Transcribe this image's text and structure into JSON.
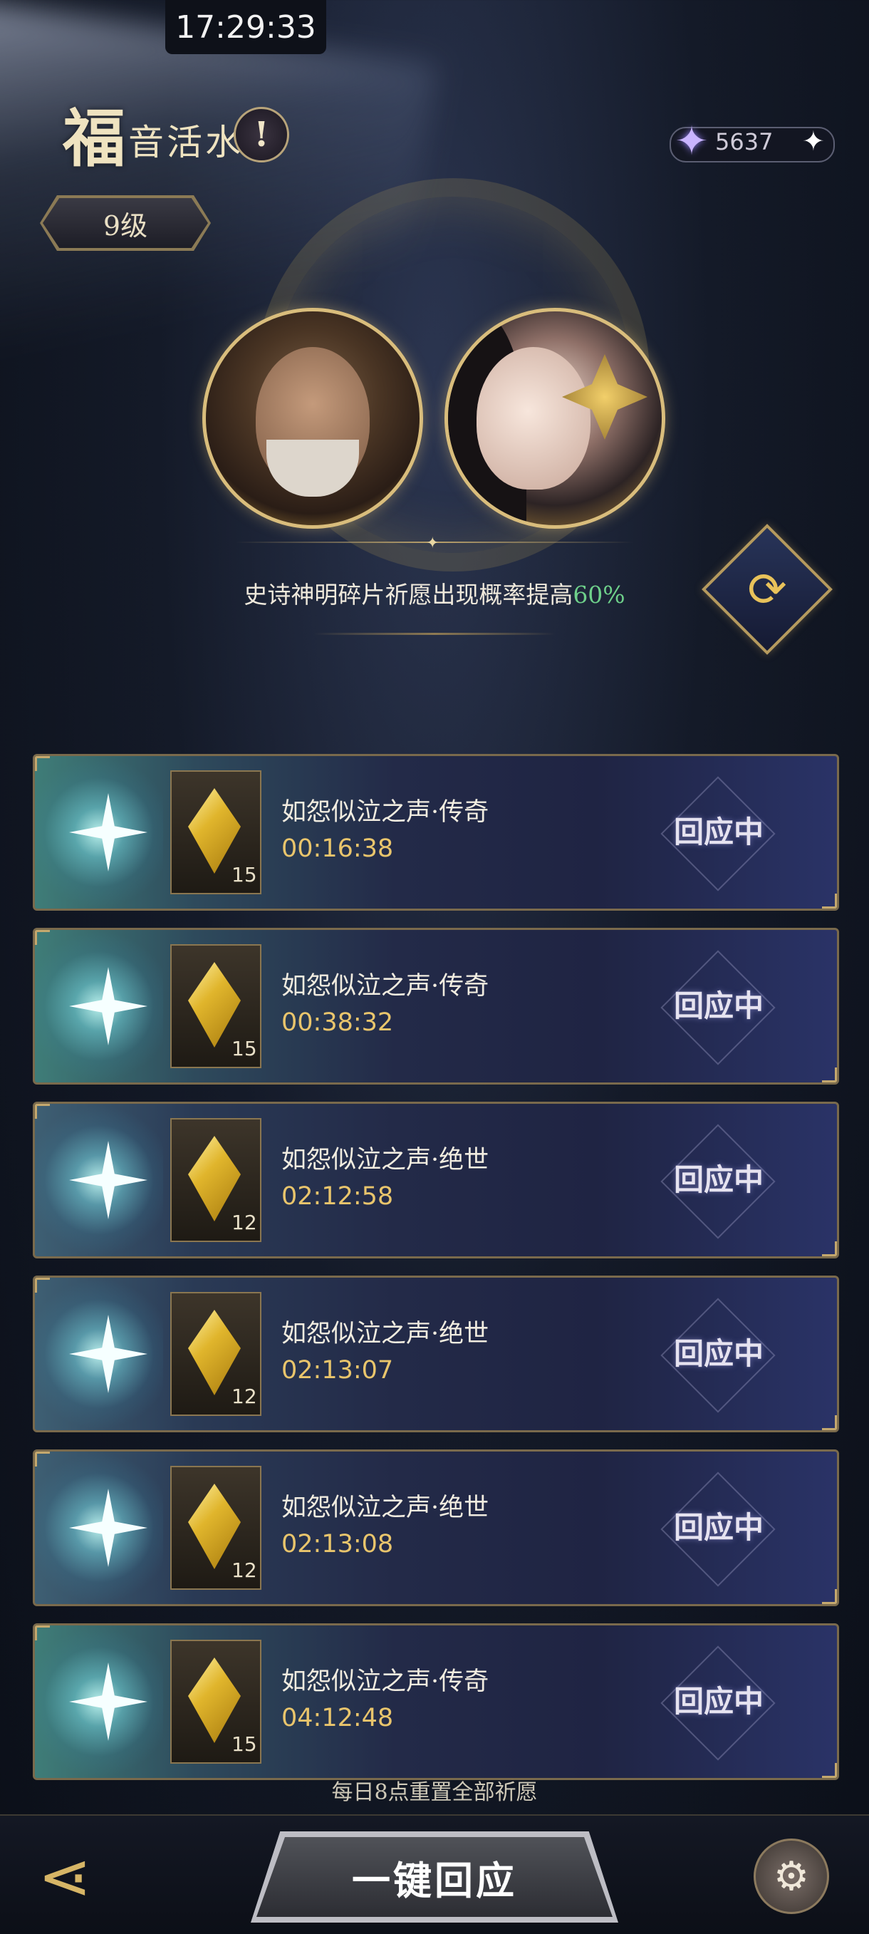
{
  "status_bar": {
    "time": "17:29:33"
  },
  "header": {
    "title_big": "福",
    "title_small": "音活水",
    "info_icon": "exclamation-icon",
    "level": "9级"
  },
  "currency": {
    "icon": "star-gem-icon",
    "value": "5637",
    "plus_icon": "plus-sparkle-icon"
  },
  "banner": {
    "boost_prefix": "史诗神明碎片祈愿出现概率提高",
    "boost_percent": "60%",
    "refresh_icon": "refresh-icon"
  },
  "wishes": [
    {
      "name": "如怨似泣之声·传奇",
      "timer": "00:16:38",
      "count": "15",
      "status": "回应中",
      "tier": "green"
    },
    {
      "name": "如怨似泣之声·传奇",
      "timer": "00:38:32",
      "count": "15",
      "status": "回应中",
      "tier": "green"
    },
    {
      "name": "如怨似泣之声·绝世",
      "timer": "02:12:58",
      "count": "12",
      "status": "回应中",
      "tier": "blue"
    },
    {
      "name": "如怨似泣之声·绝世",
      "timer": "02:13:07",
      "count": "12",
      "status": "回应中",
      "tier": "blue"
    },
    {
      "name": "如怨似泣之声·绝世",
      "timer": "02:13:08",
      "count": "12",
      "status": "回应中",
      "tier": "blue"
    },
    {
      "name": "如怨似泣之声·传奇",
      "timer": "04:12:48",
      "count": "15",
      "status": "回应中",
      "tier": "green"
    }
  ],
  "reset_note": "每日8点重置全部祈愿",
  "bottom": {
    "back_icon": "back-arrow-icon",
    "main_button": "一键回应",
    "settings_icon": "gear-icon"
  },
  "colors": {
    "accent_gold": "#d9bd7c",
    "percent_green": "#6ed08a",
    "timer_gold": "#e9c56c"
  }
}
